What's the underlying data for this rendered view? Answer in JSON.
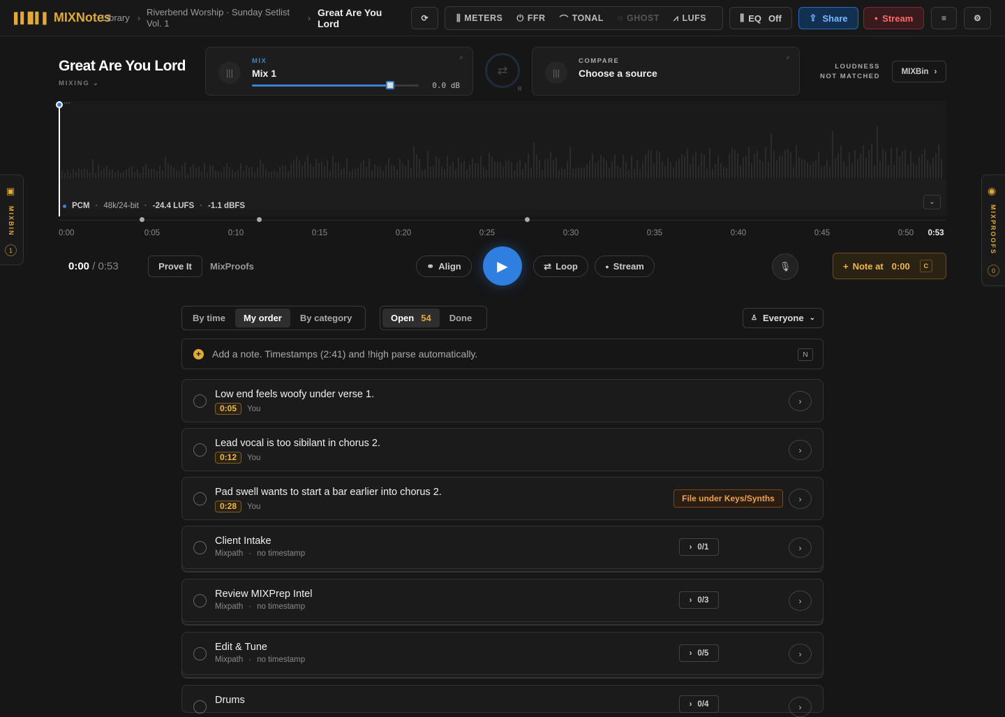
{
  "app": {
    "name_a": "MIX",
    "name_b": "Notes"
  },
  "breadcrumb": {
    "root": "Library",
    "project_line1": "Riverbend Worship · Sunday Setlist",
    "project_line2": "Vol. 1",
    "song_line1": "Great Are You",
    "song_line2": "Lord"
  },
  "toolbar": {
    "refresh_icon": "refresh-icon",
    "meters": "METERS",
    "ffr": "FFR",
    "tonal": "TONAL",
    "ghost": "GHOST",
    "lufs": "LUFS",
    "eq_label": "EQ",
    "eq_state": "Off",
    "share": "Share",
    "stream": "Stream"
  },
  "song": {
    "title": "Great Are You Lord",
    "status": "MIXING"
  },
  "mix_card": {
    "label": "MIX",
    "value": "Mix 1",
    "gain": "0.0 dB",
    "fader_level": 0.83
  },
  "compare_card": {
    "label": "COMPARE",
    "value": "Choose a source"
  },
  "swap": {
    "r_label": "R"
  },
  "loudness": {
    "line1": "LOUDNESS",
    "line2": "NOT MATCHED"
  },
  "mixbin_button": "MIXBin",
  "rails": {
    "left": {
      "label": "MIXBIN",
      "count": "1"
    },
    "right": {
      "label": "MIXPROOFS",
      "count": "0"
    }
  },
  "waveform": {
    "format": "PCM",
    "rate": "48k/24-bit",
    "lufs": "-24.4 LUFS",
    "peak": "-1.1 dBFS",
    "marker_menu": "···"
  },
  "timeline": {
    "ticks": [
      "0:00",
      "0:05",
      "0:10",
      "0:15",
      "0:20",
      "0:25",
      "0:30",
      "0:35",
      "0:40",
      "0:45",
      "0:50"
    ],
    "end": "0:53"
  },
  "transport": {
    "current": "0:00",
    "sep": " / ",
    "total": "0:53",
    "prove_it": "Prove It",
    "mixproofs": "MixProofs",
    "align": "Align",
    "loop": "Loop",
    "stream": "Stream",
    "note_at": "Note at",
    "note_time": "0:00",
    "note_key": "C"
  },
  "filters": {
    "sort": [
      "By time",
      "My order",
      "By category"
    ],
    "sort_active": "My order",
    "open_label": "Open",
    "open_count": "54",
    "done_label": "Done",
    "people": "Everyone"
  },
  "add_note": {
    "placeholder": "Add a note. Timestamps (2:41) and !high parse automatically.",
    "key": "N"
  },
  "notes": [
    {
      "title": "Low end feels woofy under verse 1.",
      "time": "0:05",
      "author": "You"
    },
    {
      "title": "Lead vocal is too sibilant in chorus 2.",
      "time": "0:12",
      "author": "You"
    },
    {
      "title": "Pad swell wants to start a bar earlier into chorus 2.",
      "time": "0:28",
      "author": "You",
      "tag": "File under Keys/Synths"
    },
    {
      "title": "Client Intake",
      "source": "Mixpath",
      "sep": "·",
      "no_ts": "no timestamp",
      "progress": "0/1"
    },
    {
      "title": "Review MIXPrep Intel",
      "source": "Mixpath",
      "sep": "·",
      "no_ts": "no timestamp",
      "progress": "0/3"
    },
    {
      "title": "Edit & Tune",
      "source": "Mixpath",
      "sep": "·",
      "no_ts": "no timestamp",
      "progress": "0/5"
    },
    {
      "title": "Drums",
      "progress": "0/4"
    }
  ]
}
